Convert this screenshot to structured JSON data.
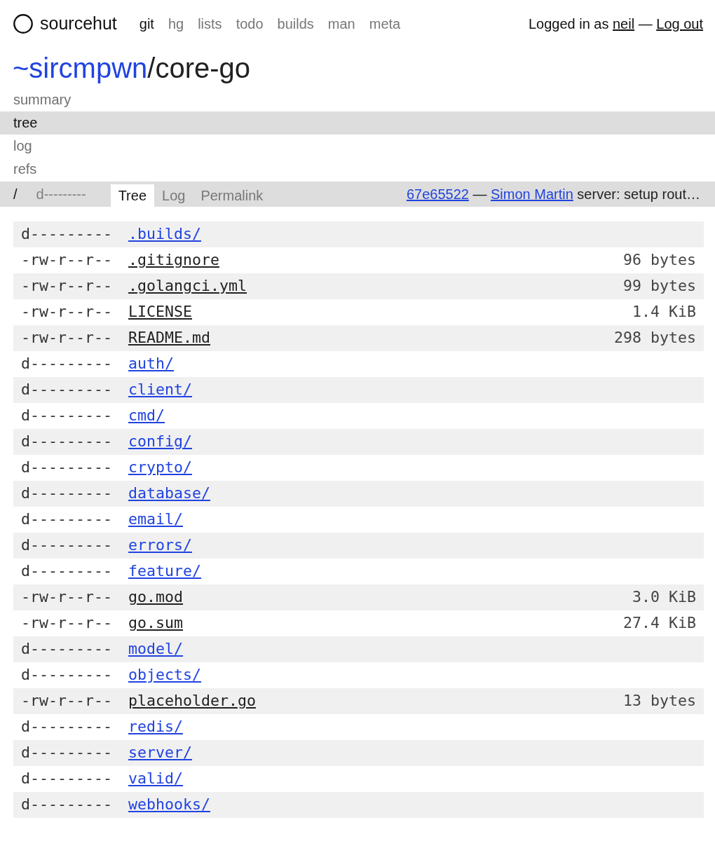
{
  "header": {
    "logo": "sourcehut",
    "nav": [
      {
        "label": "git",
        "selected": true
      },
      {
        "label": "hg",
        "selected": false
      },
      {
        "label": "lists",
        "selected": false
      },
      {
        "label": "todo",
        "selected": false
      },
      {
        "label": "builds",
        "selected": false
      },
      {
        "label": "man",
        "selected": false
      },
      {
        "label": "meta",
        "selected": false
      }
    ],
    "user": {
      "prefix": "Logged in as",
      "username": "neil",
      "separator": "—",
      "logout": "Log out"
    }
  },
  "repo": {
    "owner": "~sircmpwn",
    "separator": "/",
    "name": "core-go"
  },
  "repo_nav": [
    {
      "label": "summary",
      "selected": false
    },
    {
      "label": "tree",
      "selected": true
    },
    {
      "label": "log",
      "selected": false
    },
    {
      "label": "refs",
      "selected": false
    }
  ],
  "toolbar": {
    "path": "/",
    "mode": "d---------",
    "tabs": [
      {
        "label": "Tree",
        "selected": true
      },
      {
        "label": "Log",
        "selected": false
      },
      {
        "label": "Permalink",
        "selected": false
      }
    ],
    "commit": {
      "hash": "67e65522",
      "separator": "—",
      "author": "Simon Martin",
      "message": "server: setup rout…"
    }
  },
  "files": [
    {
      "kind": "dir",
      "mode": "d---------",
      "name": ".builds/"
    },
    {
      "kind": "file",
      "mode": "-rw-r--r--",
      "name": ".gitignore",
      "size": "96 bytes"
    },
    {
      "kind": "file",
      "mode": "-rw-r--r--",
      "name": ".golangci.yml",
      "size": "99 bytes"
    },
    {
      "kind": "file",
      "mode": "-rw-r--r--",
      "name": "LICENSE",
      "size": "1.4 KiB"
    },
    {
      "kind": "file",
      "mode": "-rw-r--r--",
      "name": "README.md",
      "size": "298 bytes"
    },
    {
      "kind": "dir",
      "mode": "d---------",
      "name": "auth/"
    },
    {
      "kind": "dir",
      "mode": "d---------",
      "name": "client/"
    },
    {
      "kind": "dir",
      "mode": "d---------",
      "name": "cmd/"
    },
    {
      "kind": "dir",
      "mode": "d---------",
      "name": "config/"
    },
    {
      "kind": "dir",
      "mode": "d---------",
      "name": "crypto/"
    },
    {
      "kind": "dir",
      "mode": "d---------",
      "name": "database/"
    },
    {
      "kind": "dir",
      "mode": "d---------",
      "name": "email/"
    },
    {
      "kind": "dir",
      "mode": "d---------",
      "name": "errors/"
    },
    {
      "kind": "dir",
      "mode": "d---------",
      "name": "feature/"
    },
    {
      "kind": "file",
      "mode": "-rw-r--r--",
      "name": "go.mod",
      "size": "3.0 KiB"
    },
    {
      "kind": "file",
      "mode": "-rw-r--r--",
      "name": "go.sum",
      "size": "27.4 KiB"
    },
    {
      "kind": "dir",
      "mode": "d---------",
      "name": "model/"
    },
    {
      "kind": "dir",
      "mode": "d---------",
      "name": "objects/"
    },
    {
      "kind": "file",
      "mode": "-rw-r--r--",
      "name": "placeholder.go",
      "size": "13 bytes"
    },
    {
      "kind": "dir",
      "mode": "d---------",
      "name": "redis/"
    },
    {
      "kind": "dir",
      "mode": "d---------",
      "name": "server/"
    },
    {
      "kind": "dir",
      "mode": "d---------",
      "name": "valid/"
    },
    {
      "kind": "dir",
      "mode": "d---------",
      "name": "webhooks/"
    }
  ]
}
